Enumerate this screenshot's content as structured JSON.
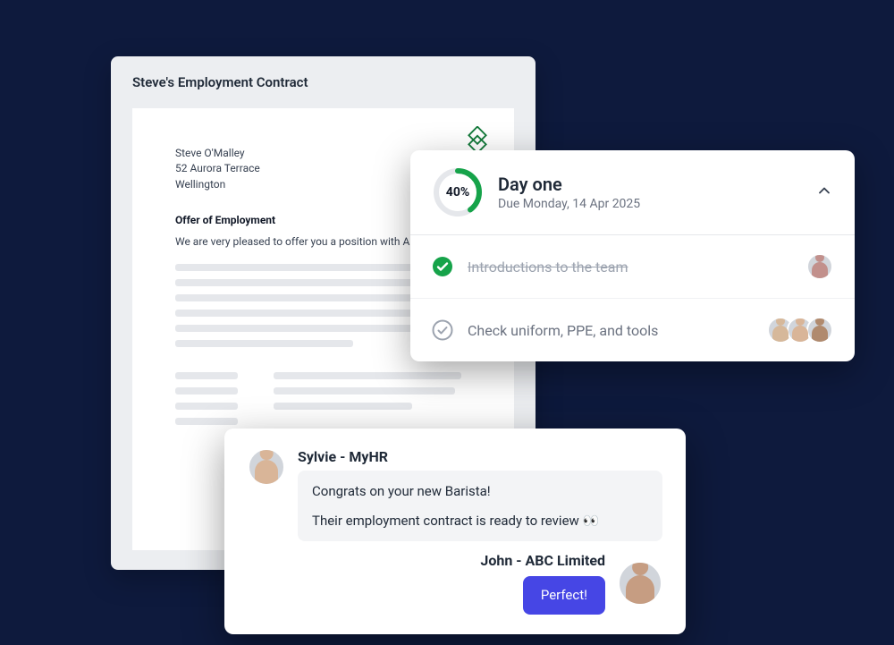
{
  "document": {
    "title": "Steve's Employment Contract",
    "recipient_name": "Steve O'Malley",
    "recipient_address1": "52 Aurora Terrace",
    "recipient_address2": "Wellington",
    "heading": "Offer of Employment",
    "body_first_line": "We are very pleased to offer you a position with ABC Limited",
    "logo_color": "#147a3b"
  },
  "checklist": {
    "progress_pct": 40,
    "progress_label": "40%",
    "title": "Day one",
    "due": "Due Monday, 14 Apr 2025",
    "items": [
      {
        "label": "Introductions to the team",
        "done": true,
        "assignees": 1
      },
      {
        "label": "Check uniform, PPE, and tools",
        "done": false,
        "assignees": 3
      }
    ],
    "colors": {
      "ring_done": "#16a34a",
      "ring_track": "#e5e7eb"
    }
  },
  "chat": {
    "messages": [
      {
        "side": "left",
        "sender": "Sylvie - MyHR",
        "lines": [
          "Congrats on your new Barista!",
          "Their employment contract is ready to review 👀"
        ]
      },
      {
        "side": "right",
        "sender": "John - ABC Limited",
        "lines": [
          "Perfect!"
        ]
      }
    ],
    "primary_color": "#4646e5"
  }
}
